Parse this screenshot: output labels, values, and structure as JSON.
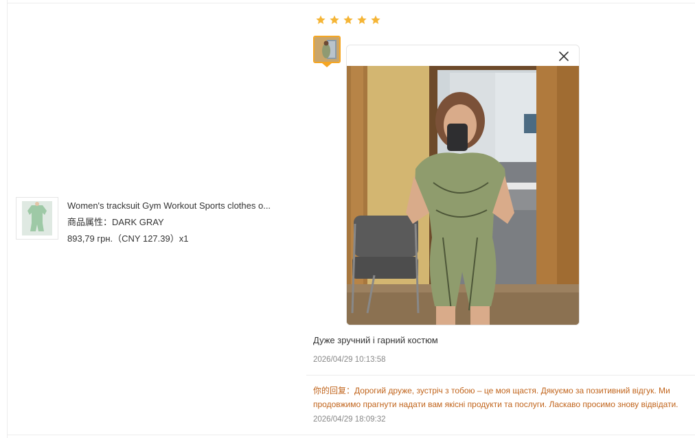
{
  "product": {
    "title": "Women's tracksuit Gym Workout Sports clothes o...",
    "attr_label": "商品属性：",
    "attr_value": "DARK GRAY",
    "price": "893,79 грн.（CNY  127.39）x1"
  },
  "review": {
    "rating": 5,
    "star_color": "#f5b536",
    "text": "Дуже зручний і гарний костюм",
    "date": "2026/04/29 10:13:58",
    "reply_label": "你的回复：",
    "reply_text": "Дорогий друже, зустріч з тобою – це моя щастя. Дякуємо за позитивний відгук. Ми продовжимо прагнути надати вам якісні продукти та послуги. Ласкаво просимо знову відвідати.",
    "reply_date": "2026/04/29 18:09:32"
  },
  "viewer": {
    "close_icon": "close-icon"
  }
}
